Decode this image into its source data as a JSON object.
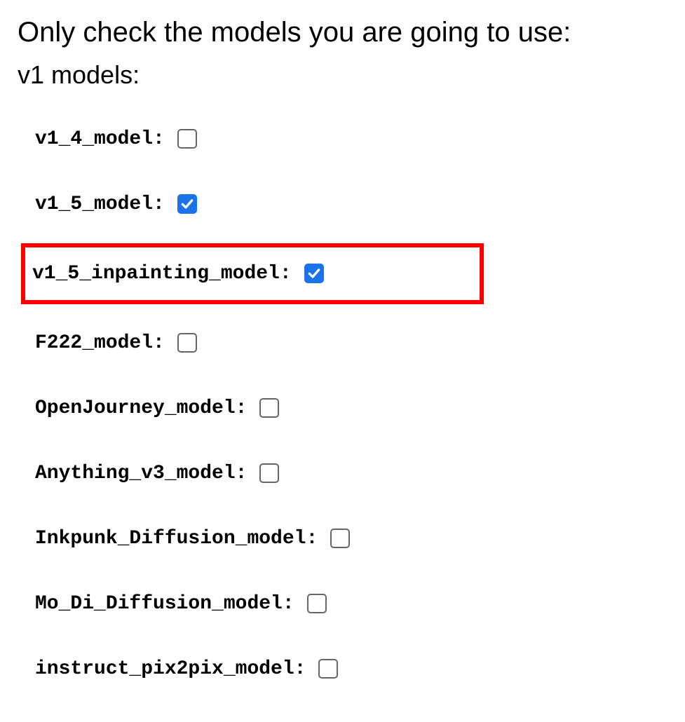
{
  "heading": "Only check the models you are going to use:",
  "subheading": "v1 models:",
  "models": [
    {
      "label": "v1_4_model:",
      "checked": false,
      "highlighted": false,
      "name": "v1-4-model"
    },
    {
      "label": "v1_5_model:",
      "checked": true,
      "highlighted": false,
      "name": "v1-5-model"
    },
    {
      "label": "v1_5_inpainting_model:",
      "checked": true,
      "highlighted": true,
      "name": "v1-5-inpainting-model"
    },
    {
      "label": "F222_model:",
      "checked": false,
      "highlighted": false,
      "name": "f222-model"
    },
    {
      "label": "OpenJourney_model:",
      "checked": false,
      "highlighted": false,
      "name": "openjourney-model"
    },
    {
      "label": "Anything_v3_model:",
      "checked": false,
      "highlighted": false,
      "name": "anything-v3-model"
    },
    {
      "label": "Inkpunk_Diffusion_model:",
      "checked": false,
      "highlighted": false,
      "name": "inkpunk-diffusion-model"
    },
    {
      "label": "Mo_Di_Diffusion_model:",
      "checked": false,
      "highlighted": false,
      "name": "mo-di-diffusion-model"
    },
    {
      "label": "instruct_pix2pix_model:",
      "checked": false,
      "highlighted": false,
      "name": "instruct-pix2pix-model"
    }
  ]
}
